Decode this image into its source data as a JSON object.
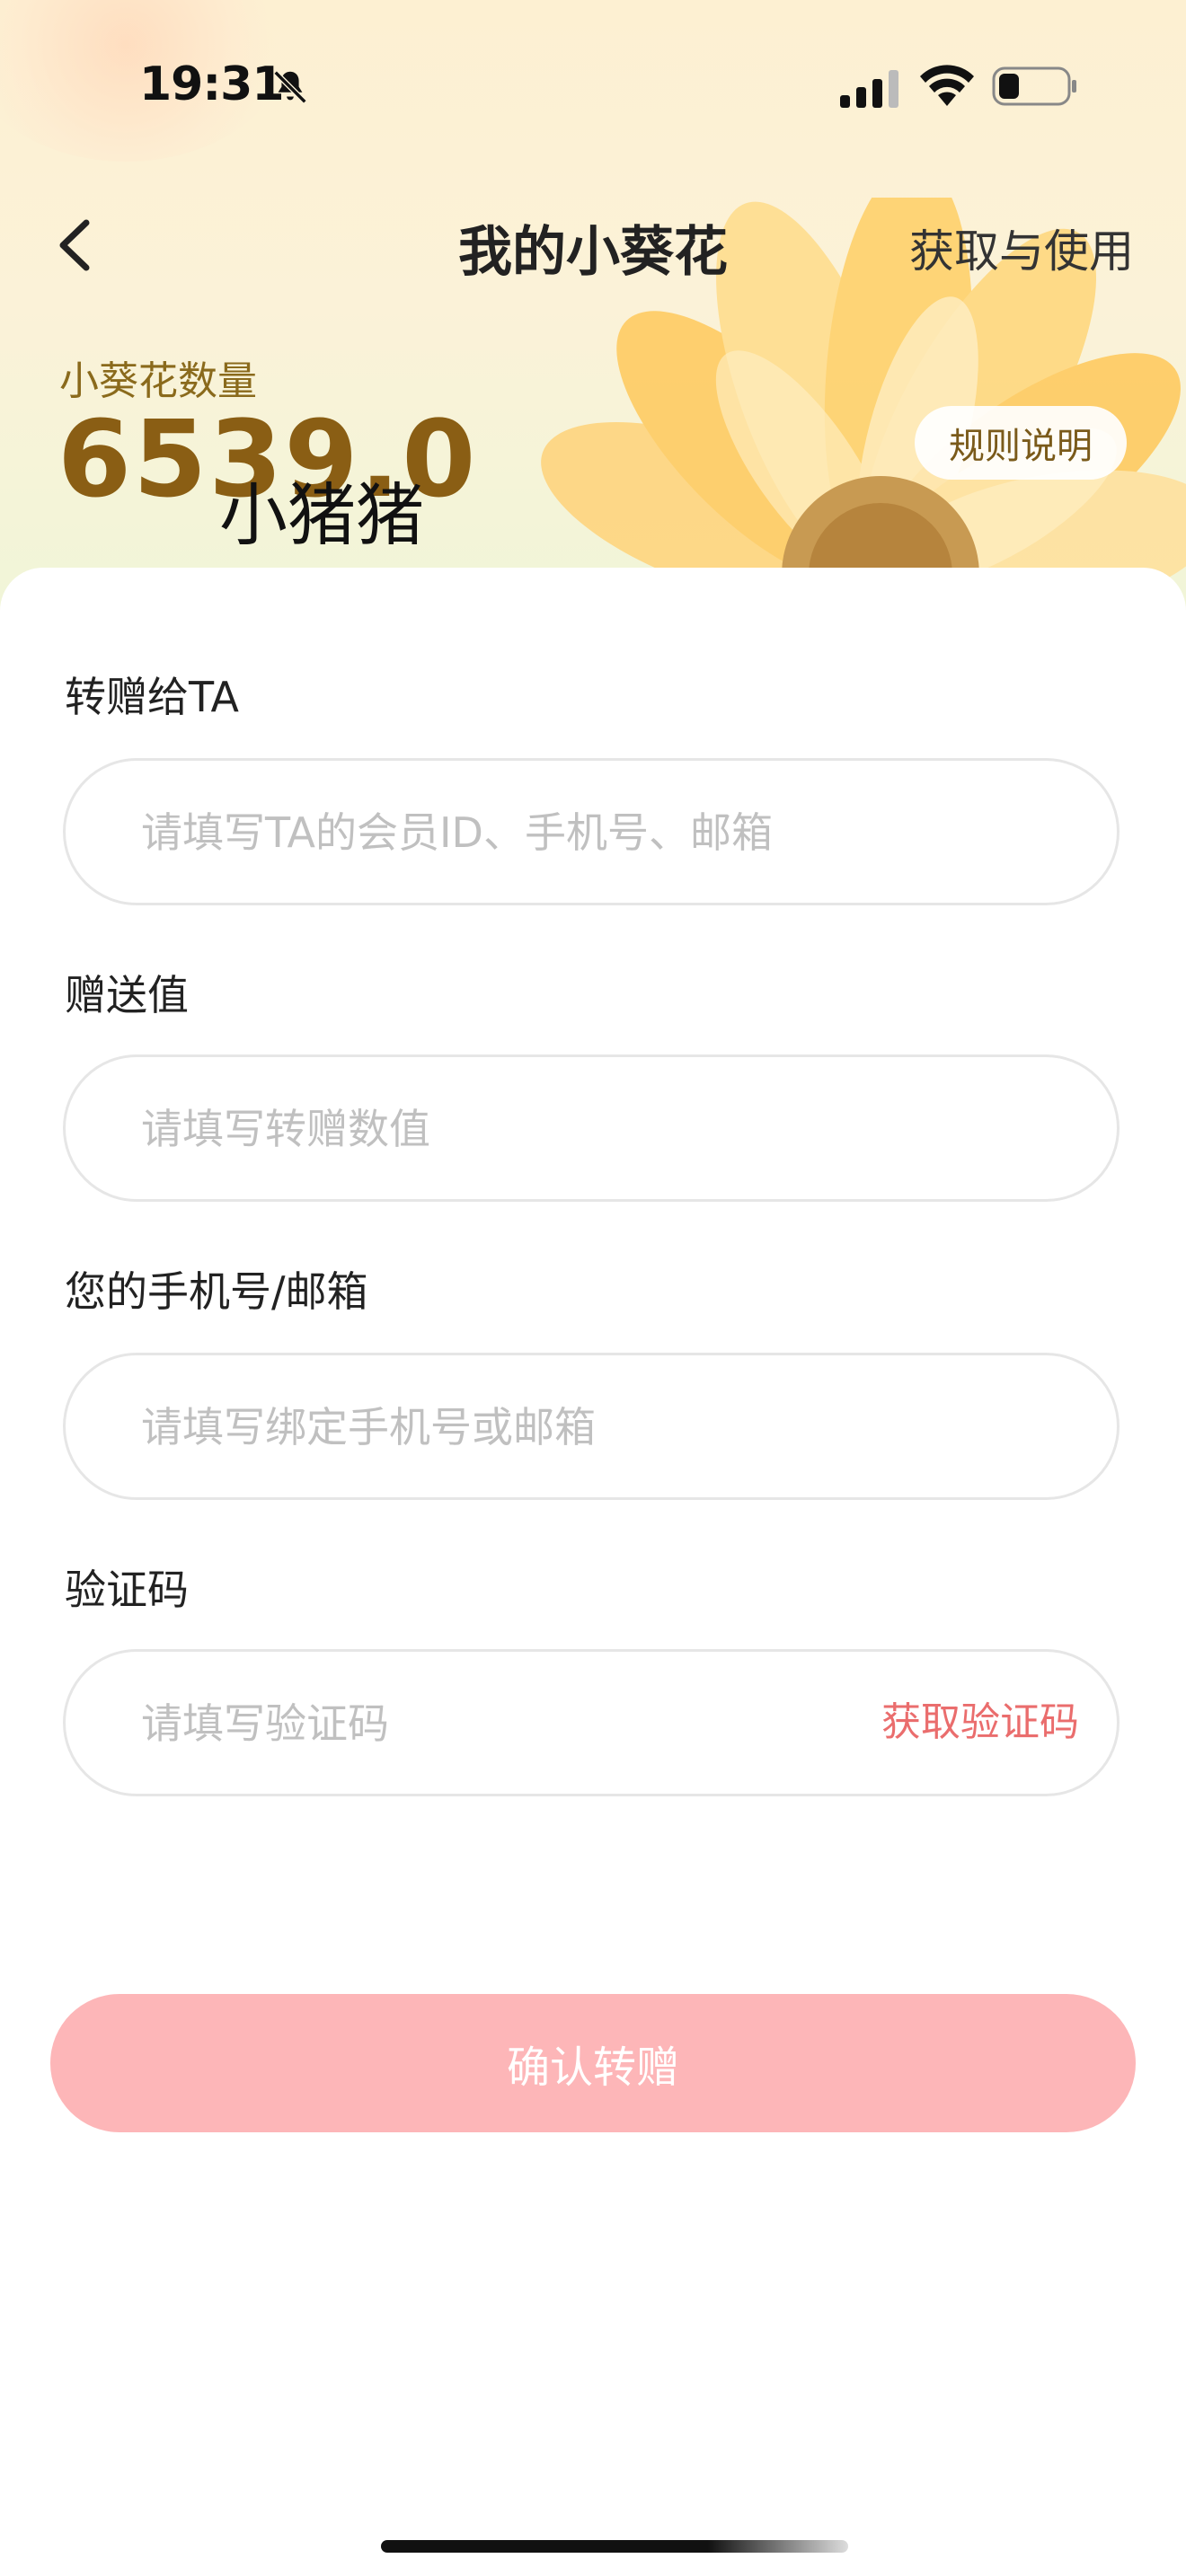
{
  "status_bar": {
    "time": "19:31",
    "icons": [
      "bell-slash-icon",
      "signal-icon",
      "wifi-icon",
      "battery-icon"
    ]
  },
  "nav": {
    "title": "我的小葵花",
    "right_link": "获取与使用",
    "back_icon": "chevron-left-icon"
  },
  "summary": {
    "label": "小葵花数量",
    "value": "6539.0",
    "overlay_text": "小猪猪",
    "rules_button": "规则说明"
  },
  "form": {
    "recipient": {
      "label": "转赠给TA",
      "placeholder": "请填写TA的会员ID、手机号、邮箱",
      "value": ""
    },
    "amount": {
      "label": "赠送值",
      "placeholder": "请填写转赠数值",
      "value": ""
    },
    "contact": {
      "label": "您的手机号/邮箱",
      "placeholder": "请填写绑定手机号或邮箱",
      "value": ""
    },
    "code": {
      "label": "验证码",
      "placeholder": "请填写验证码",
      "value": "",
      "get_code": "获取验证码"
    },
    "confirm": "确认转赠"
  },
  "colors": {
    "accent_gold": "#8a5e14",
    "link_red": "#ea6d6d",
    "button_pink": "#fdb6b8"
  }
}
